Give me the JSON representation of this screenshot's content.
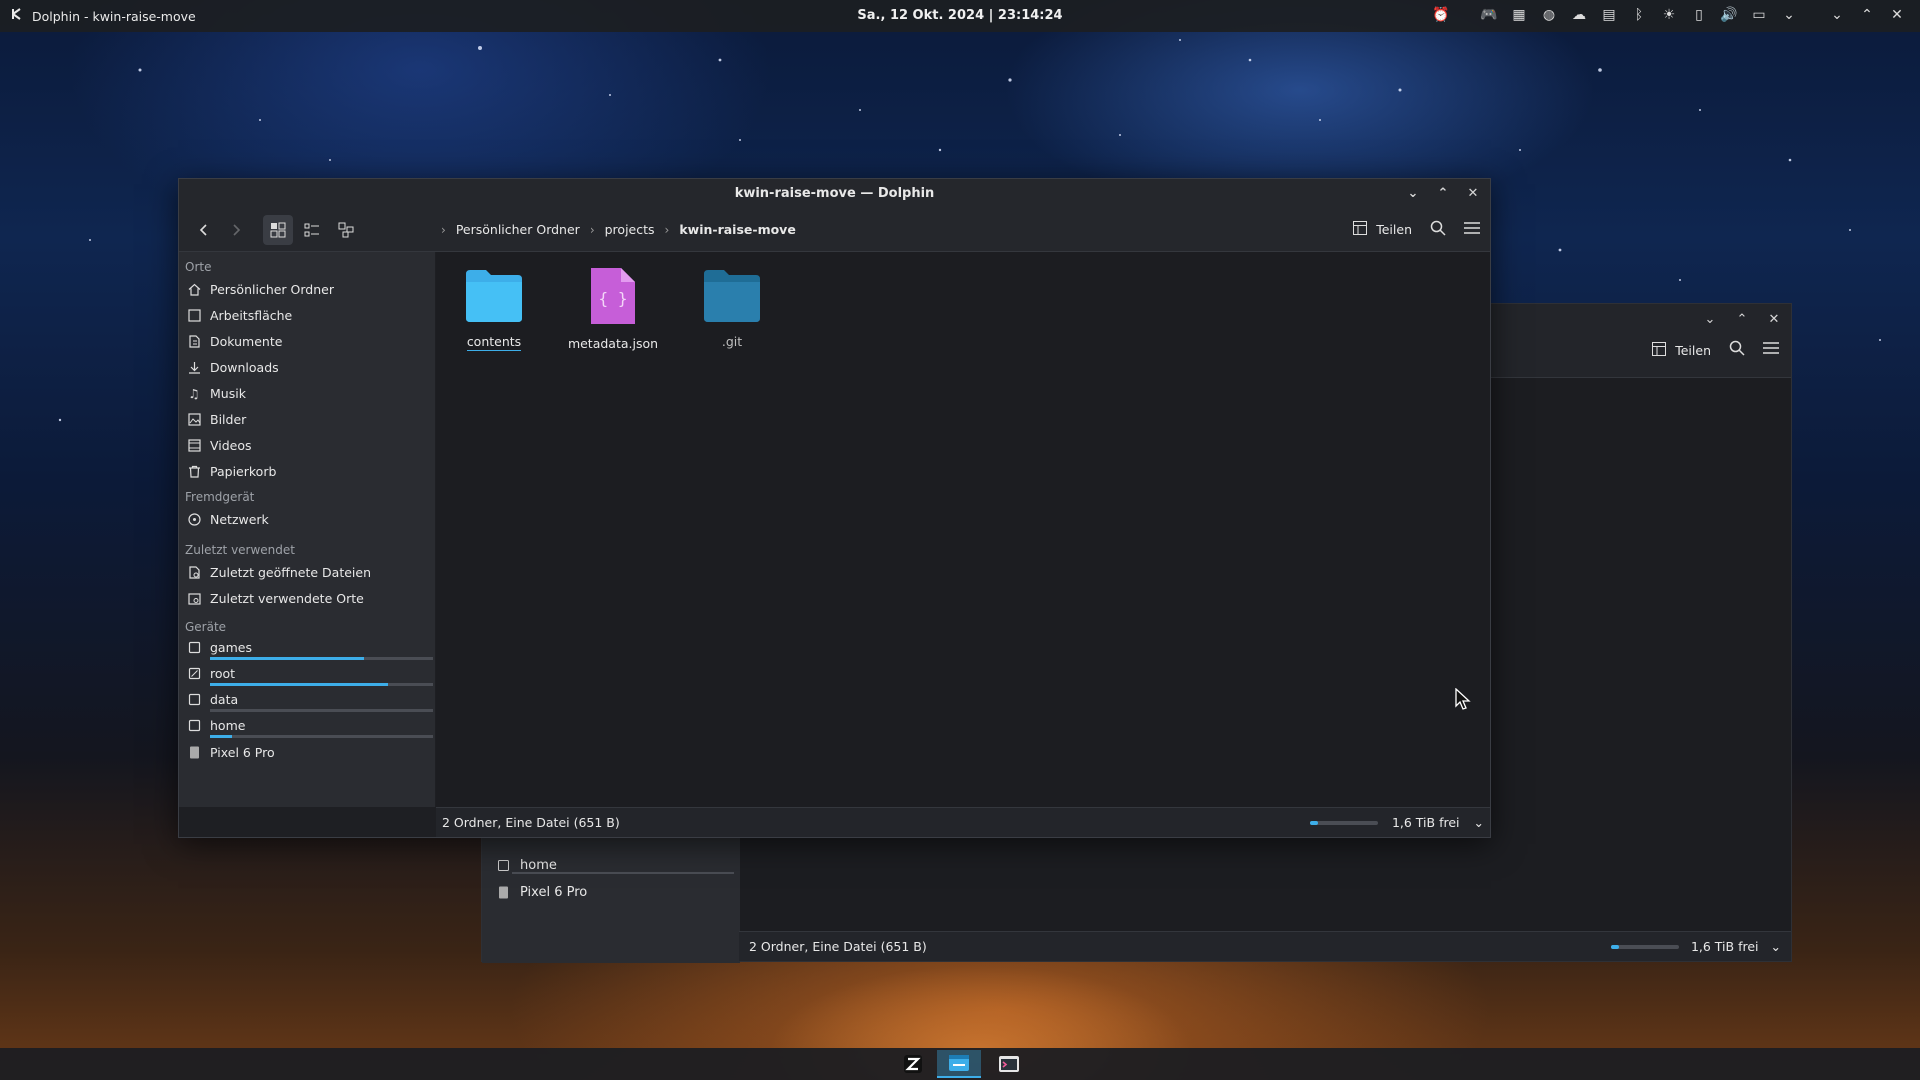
{
  "top_panel": {
    "app_title": "Dolphin - kwin-raise-move",
    "clock": "Sa., 12 Okt. 2024 | 23:14:24"
  },
  "main_window": {
    "title": "kwin-raise-move — Dolphin",
    "breadcrumb": [
      "Persönlicher Ordner",
      "projects",
      "kwin-raise-move"
    ],
    "share_label": "Teilen",
    "sidebar": {
      "section_places": "Orte",
      "places": [
        "Persönlicher Ordner",
        "Arbeitsfläche",
        "Dokumente",
        "Downloads",
        "Musik",
        "Bilder",
        "Videos",
        "Papierkorb"
      ],
      "section_remote": "Fremdgerät",
      "remote": [
        "Netzwerk"
      ],
      "section_recent": "Zuletzt verwendet",
      "recent": [
        "Zuletzt geöffnete Dateien",
        "Zuletzt verwendete Orte"
      ],
      "section_devices": "Geräte",
      "devices": [
        {
          "label": "games",
          "usage": 0.69
        },
        {
          "label": "root",
          "usage": 0.8
        },
        {
          "label": "data",
          "usage": 0.0
        },
        {
          "label": "home",
          "usage": 0.1
        },
        {
          "label": "Pixel 6 Pro"
        }
      ]
    },
    "files": [
      {
        "name": "contents",
        "type": "folder",
        "color": "#3daee9"
      },
      {
        "name": "metadata.json",
        "type": "json",
        "color": "#c65ed8"
      },
      {
        "name": ".git",
        "type": "folder",
        "color": "#2a7fad"
      }
    ],
    "status": "2 Ordner, Eine Datei (651 B)",
    "free_space": "1,6 TiB frei",
    "free_space_used_fraction": 0.12
  },
  "back_window": {
    "share_label": "Teilen",
    "sidebar_items": [
      "home",
      "Pixel 6 Pro"
    ],
    "status": "2 Ordner, Eine Datei (651 B)",
    "free_space": "1,6 TiB frei"
  },
  "colors": {
    "accent": "#3daee9"
  }
}
